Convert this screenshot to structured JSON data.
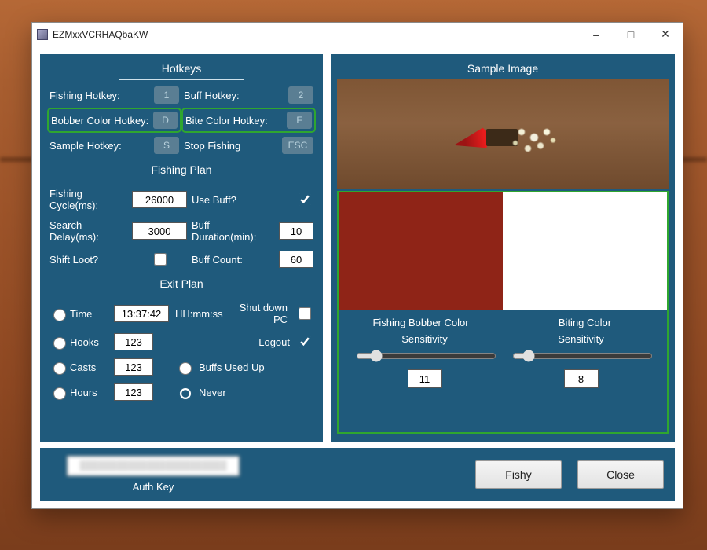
{
  "window": {
    "title": "EZMxxVCRHAQbaKW"
  },
  "left": {
    "hotkeys_title": "Hotkeys",
    "fishing_hotkey_label": "Fishing Hotkey:",
    "fishing_hotkey_value": "1",
    "buff_hotkey_label": "Buff Hotkey:",
    "buff_hotkey_value": "2",
    "bobber_color_hotkey_label": "Bobber Color Hotkey:",
    "bobber_color_hotkey_value": "D",
    "bite_color_hotkey_label": "Bite Color Hotkey:",
    "bite_color_hotkey_value": "F",
    "sample_hotkey_label": "Sample Hotkey:",
    "sample_hotkey_value": "S",
    "stop_fishing_label": "Stop Fishing",
    "stop_fishing_value": "ESC",
    "fishing_plan_title": "Fishing Plan",
    "fishing_cycle_label": "Fishing Cycle(ms):",
    "fishing_cycle_value": "26000",
    "use_buff_label": "Use Buff?",
    "use_buff_checked": true,
    "search_delay_label": "Search Delay(ms):",
    "search_delay_value": "3000",
    "buff_duration_label": "Buff Duration(min):",
    "buff_duration_value": "10",
    "shift_loot_label": "Shift Loot?",
    "shift_loot_checked": false,
    "buff_count_label": "Buff Count:",
    "buff_count_value": "60",
    "exit_plan_title": "Exit Plan",
    "time_label": "Time",
    "time_value": "13:37:42",
    "time_format": "HH:mm:ss",
    "shutdown_label": "Shut down PC",
    "shutdown_checked": false,
    "hooks_label": "Hooks",
    "hooks_value": "123",
    "logout_label": "Logout",
    "logout_checked": true,
    "casts_label": "Casts",
    "casts_value": "123",
    "buffs_used_label": "Buffs Used Up",
    "hours_label": "Hours",
    "hours_value": "123",
    "never_label": "Never"
  },
  "right": {
    "sample_title": "Sample Image",
    "bobber_color_label": "Fishing Bobber Color",
    "bobber_color": "#8f2417",
    "biting_color_label": "Biting Color",
    "biting_color": "#ffffff",
    "sensitivity_label": "Sensitivity",
    "bobber_sensitivity_value": "11",
    "biting_sensitivity_value": "8"
  },
  "bottom": {
    "auth_key_label": "Auth Key",
    "auth_key_value": "████████████████████████",
    "fishy_label": "Fishy",
    "close_label": "Close"
  }
}
